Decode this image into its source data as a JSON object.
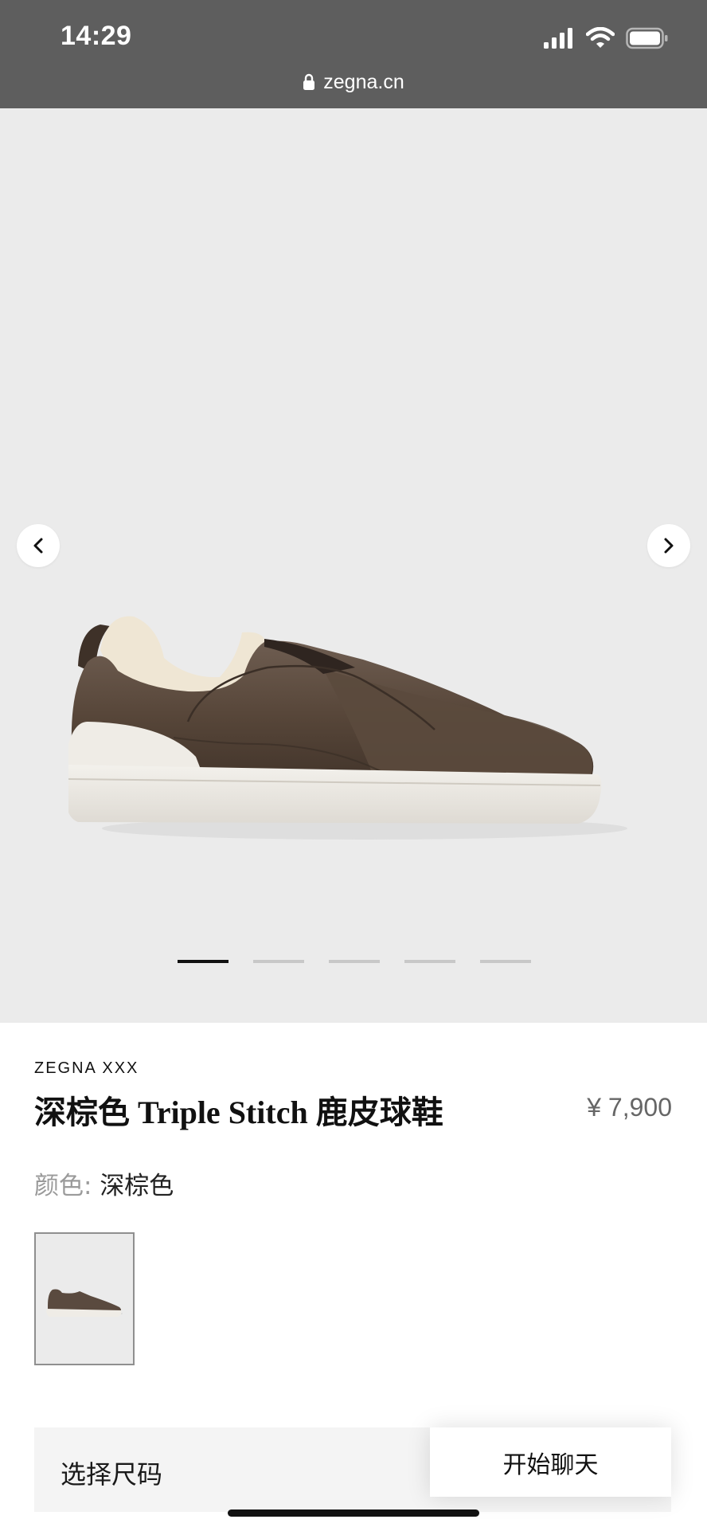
{
  "status_bar": {
    "time": "14:29",
    "icons": [
      "signal-icon",
      "wifi-icon",
      "battery-icon"
    ]
  },
  "url_bar": {
    "domain": "zegna.cn",
    "icon": "lock-icon"
  },
  "gallery": {
    "image": "dark-brown-slip-on-sneaker",
    "prev_icon": "chevron-left-icon",
    "next_icon": "chevron-right-icon",
    "slide_count": 5,
    "active_slide": 1
  },
  "product": {
    "brand": "ZEGNA XXX",
    "title": "深棕色 Triple Stitch 鹿皮球鞋",
    "price": "¥ 7,900",
    "color_label": "颜色:",
    "color_value": "深棕色"
  },
  "actions": {
    "size_label": "选择尺码",
    "chat_label": "开始聊天"
  },
  "colors": {
    "status_bar_bg": "#5e5e5e",
    "gallery_bg": "#ebebeb",
    "shoe_leather": "#5a4a3f",
    "sole": "#efece6"
  }
}
